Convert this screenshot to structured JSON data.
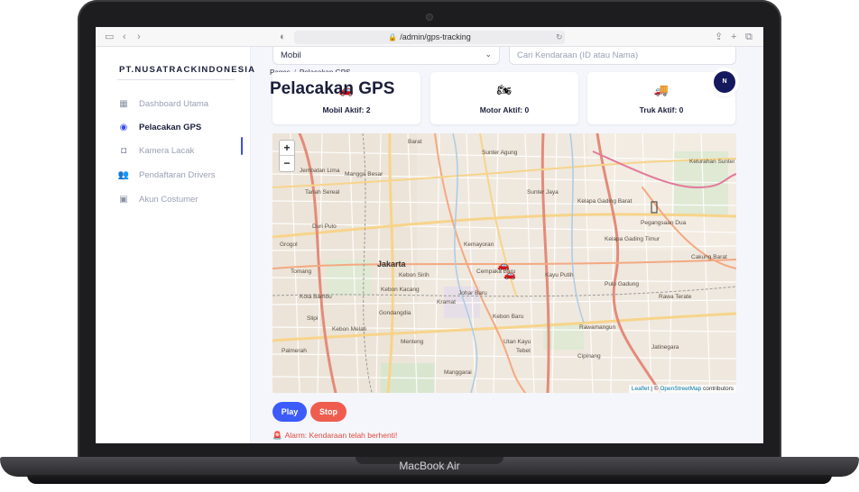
{
  "device": {
    "brand": "MacBook Air"
  },
  "browser": {
    "url": "/admin/gps-tracking"
  },
  "sidebar": {
    "brand": "PT.NUSATRACKINDONESIA",
    "items": [
      {
        "label": "Dashboard Utama",
        "icon": "dashboard-icon"
      },
      {
        "label": "Pelacakan GPS",
        "icon": "gps-target-icon",
        "active": true
      },
      {
        "label": "Kamera Lacak",
        "icon": "camera-icon"
      },
      {
        "label": "Pendaftaran Drivers",
        "icon": "users-icon"
      },
      {
        "label": "Akun Costumer",
        "icon": "account-icon"
      }
    ]
  },
  "filters": {
    "vehicle_type": "Mobil",
    "search_placeholder": "Cari Kendaraan (ID atau Nama)"
  },
  "breadcrumb": {
    "root": "Pages",
    "current": "Pelacakan GPS"
  },
  "page_title": "Pelacakan GPS",
  "stats": [
    {
      "label": "Mobil Aktif: 2",
      "icon": "car-icon"
    },
    {
      "label": "Motor Aktif: 0",
      "icon": "motorcycle-icon"
    },
    {
      "label": "Truk Aktif: 0",
      "icon": "truck-icon"
    }
  ],
  "avatar": {
    "initial": "N"
  },
  "map": {
    "zoom_in": "+",
    "zoom_out": "−",
    "attribution_leaflet": "Leaflet",
    "attribution_sep": " | © ",
    "attribution_osm": "OpenStreetMap",
    "attribution_tail": " contributors",
    "labels": [
      "Barat",
      "Sunter Agung",
      "Sunter Jaya",
      "Kelapa Gading Barat",
      "Pegangsaan Dua",
      "Kelapa Gading Timur",
      "Kelurahan Sunter",
      "Kemayoran",
      "Cempaka Baru",
      "Kayu Putih",
      "Pulo Gadung",
      "Rawamangun",
      "Rawa Terate",
      "Cakung Barat",
      "Jakarta",
      "Menteng",
      "Kebon Kacang",
      "Kebon Sirih",
      "Gondangdia",
      "Johar Baru",
      "Kramat",
      "Kebon Melati",
      "Tebet",
      "Kebon Baru",
      "Utan Kayu",
      "Cipinang",
      "Jatinegara",
      "Manggarai",
      "Duri Pulo",
      "Tomang",
      "Grogol",
      "Jembatan Lima",
      "Mangga Besar",
      "Tanah Sereal",
      "Kota Bambu",
      "Slipi",
      "Palmerah",
      "Senayan",
      "Kebayoran Baru",
      "Kuningan",
      "Pasar Minggu",
      "Pejaten",
      "Duren Sawit",
      "Cawang",
      "Bidara Cina",
      "Kampung Melayu",
      "Pondok Bambu",
      "Pulo Gebang",
      "Klender",
      "Penggilingan",
      "Jatinegara Kaum",
      "Pisangan Timur",
      "Pisangan Baru",
      "Kebon Manggis",
      "Pal Meriam",
      "Bali Mester",
      "Cideng",
      "Petojo Utara",
      "Harapan Mulya",
      "Utan Panjang",
      "Serdang"
    ]
  },
  "controls": {
    "play": "Play",
    "stop": "Stop"
  },
  "alarm": {
    "text": "Alarm: Kendaraan telah berhenti!",
    "icon": "alarm-icon"
  },
  "colors": {
    "accent": "#3d4ee8",
    "play": "#3b5bfd",
    "stop": "#ef5d4f",
    "alarm": "#e04a3e",
    "avatar": "#14185c"
  }
}
